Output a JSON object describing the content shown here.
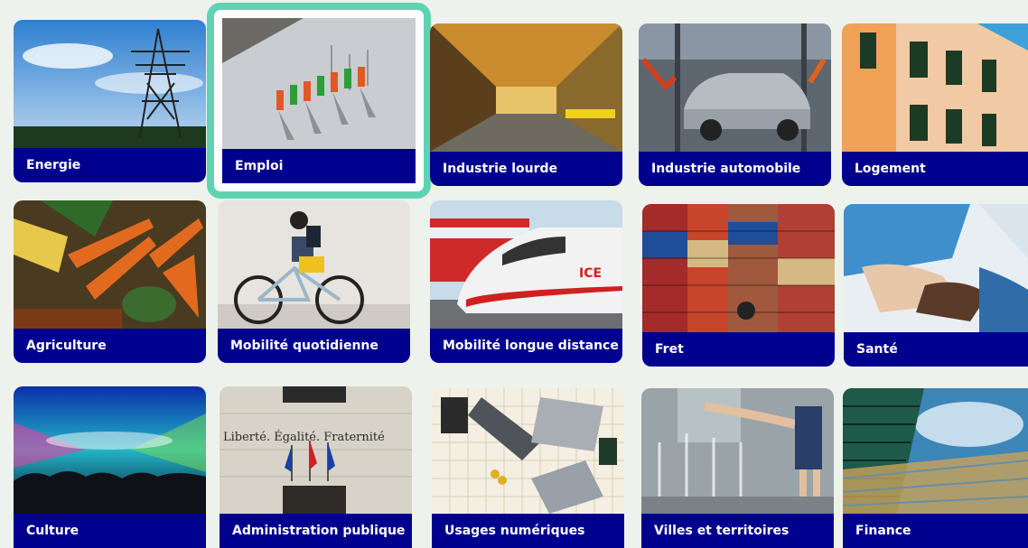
{
  "grid": {
    "tiles": [
      {
        "label": "Energie",
        "icon": "power-pylon-photo",
        "selected": false
      },
      {
        "label": "Emploi",
        "icon": "workers-aerial-photo",
        "selected": true
      },
      {
        "label": "Industrie lourde",
        "icon": "factory-hall-photo",
        "selected": false
      },
      {
        "label": "Industrie automobile",
        "icon": "car-assembly-photo",
        "selected": false
      },
      {
        "label": "Logement",
        "icon": "building-facade-photo",
        "selected": false
      },
      {
        "label": "Agriculture",
        "icon": "vegetables-photo",
        "selected": false
      },
      {
        "label": "Mobilité quotidienne",
        "icon": "cyclist-photo",
        "selected": false
      },
      {
        "label": "Mobilité longue distance",
        "icon": "high-speed-train-photo",
        "selected": false
      },
      {
        "label": "Fret",
        "icon": "shipping-containers-photo",
        "selected": false
      },
      {
        "label": "Santé",
        "icon": "caregiver-hands-photo",
        "selected": false
      },
      {
        "label": "Culture",
        "icon": "concert-crowd-photo",
        "selected": false
      },
      {
        "label": "Administration publique",
        "icon": "town-hall-photo",
        "selected": false
      },
      {
        "label": "Usages numériques",
        "icon": "laptops-desk-photo",
        "selected": false
      },
      {
        "label": "Villes et territoires",
        "icon": "city-fountain-photo",
        "selected": false
      },
      {
        "label": "Finance",
        "icon": "glass-tower-photo",
        "selected": false
      }
    ],
    "engraving": "Liberté. Égalité. Fraternité",
    "train_mark": "ICE",
    "colors": {
      "label_bar": "#00008f",
      "selection": "#5fd3b1"
    }
  }
}
